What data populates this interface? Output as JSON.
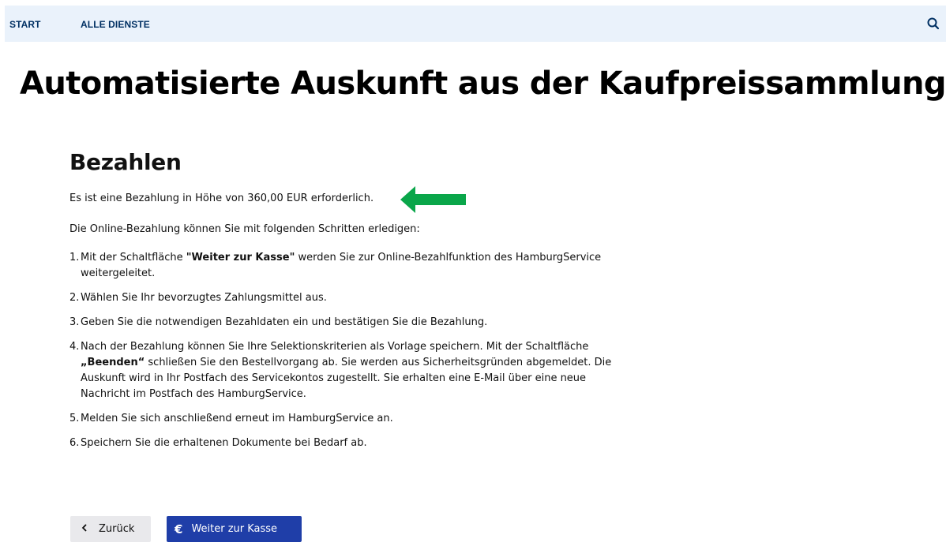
{
  "nav": {
    "start_label": "START",
    "all_services_label": "ALLE DIENSTE",
    "search_icon": "search-icon"
  },
  "page": {
    "title": "Automatisierte Auskunft aus der Kaufpreissammlung"
  },
  "payment": {
    "heading": "Bezahlen",
    "amount_text": "Es ist eine Bezahlung in Höhe von 360,00 EUR erforderlich.",
    "intro_text": "Die Online-Bezahlung können Sie mit folgenden Schritten erledigen:",
    "steps": [
      {
        "number": "1.",
        "before": "Mit der Schaltfläche ",
        "bold": "\"Weiter zur Kasse\"",
        "after": " werden Sie zur Online-Bezahlfunktion des HamburgService weitergeleitet."
      },
      {
        "number": "2.",
        "text": "Wählen Sie Ihr bevorzugtes Zahlungsmittel aus."
      },
      {
        "number": "3.",
        "text": "Geben Sie die notwendigen Bezahldaten ein und bestätigen Sie die Bezahlung."
      },
      {
        "number": "4.",
        "before": "Nach der Bezahlung können Sie Ihre Selektionskriterien als Vorlage speichern. Mit der Schaltfläche ",
        "bold": "„Beenden“",
        "after": " schließen Sie den Bestellvorgang ab. Sie werden aus Sicherheitsgründen abgemeldet. Die Auskunft wird in Ihr Postfach des Servicekontos zugestellt. Sie erhalten eine E-Mail über eine neue Nachricht im Postfach des HamburgService."
      },
      {
        "number": "5.",
        "text": "Melden Sie sich anschließend erneut im HamburgService an."
      },
      {
        "number": "6.",
        "text": "Speichern Sie die erhaltenen Dokumente bei Bedarf ab."
      }
    ],
    "arrow_color": "#0aa64a"
  },
  "actions": {
    "back_label": "Zurück",
    "back_icon": "chevron-left-icon",
    "checkout_label": "Weiter zur Kasse",
    "checkout_icon": "euro-icon",
    "checkout_color": "#1f3ea8"
  }
}
